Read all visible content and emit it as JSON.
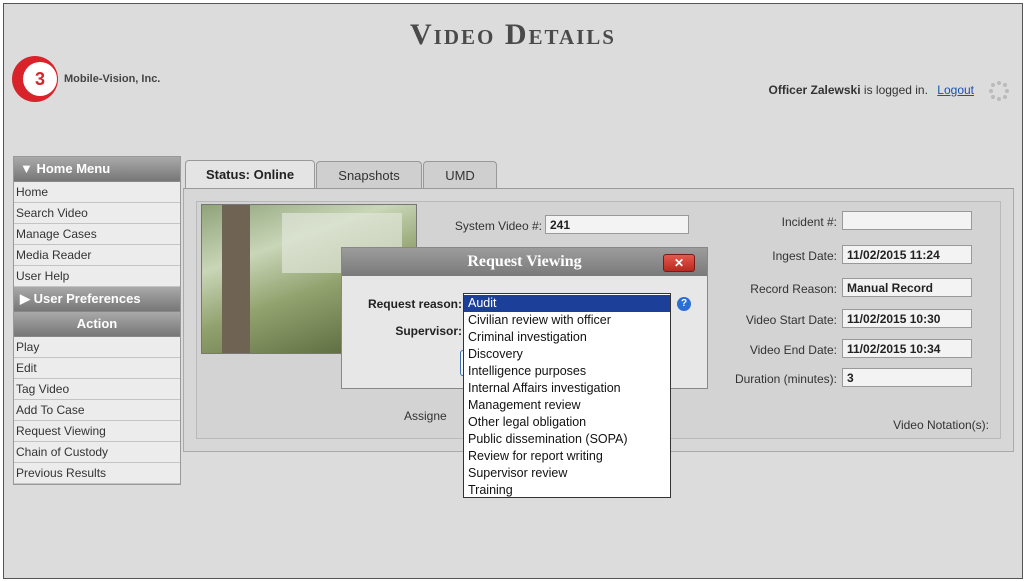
{
  "page": {
    "title": "Video Details",
    "logo_text": "Mobile-Vision, Inc.",
    "logo_mark": "3",
    "login_user": "Officer Zalewski",
    "login_suffix": " is logged in.",
    "logout_label": "Logout"
  },
  "sidebar": {
    "home_menu_header": "▼ Home Menu",
    "home_items": [
      "Home",
      "Search Video",
      "Manage Cases",
      "Media Reader",
      "User Help"
    ],
    "user_prefs_header": "▶ User Preferences",
    "action_header": "Action",
    "action_items": [
      "Play",
      "Edit",
      "Tag Video",
      "Add To Case",
      "Request Viewing",
      "Chain of Custody",
      "Previous Results"
    ]
  },
  "tabs": [
    {
      "label": "Status: Online",
      "active": true
    },
    {
      "label": "Snapshots",
      "active": false
    },
    {
      "label": "UMD",
      "active": false
    }
  ],
  "details": {
    "system_video_label": "System Video #:",
    "system_video_value": "241",
    "incident_label": "Incident #:",
    "incident_value": "",
    "ingest_date_label": "Ingest Date:",
    "ingest_date_value": "11/02/2015 11:24",
    "record_reason_label": "Record Reason:",
    "record_reason_value": "Manual Record",
    "video_start_label": "Video Start Date:",
    "video_start_value": "11/02/2015 10:30",
    "video_end_label": "Video End Date:",
    "video_end_value": "11/02/2015 10:34",
    "duration_label": "Duration (minutes):",
    "duration_value": "3",
    "assigned_label_partial": "Assigne",
    "notation_label": "Video Notation(s):"
  },
  "modal": {
    "title": "Request Viewing",
    "close_label": "✕",
    "request_reason_label": "Request reason:",
    "supervisor_label": "Supervisor:",
    "help_icon": "?",
    "options": [
      "Audit",
      "Civilian review with officer",
      "Criminal investigation",
      "Discovery",
      "Intelligence purposes",
      "Internal Affairs investigation",
      "Management review",
      "Other legal obligation",
      "Public dissemination (SOPA)",
      "Review for report writing",
      "Supervisor review",
      "Training"
    ],
    "selected_option": "Audit"
  },
  "colors": {
    "background": "#dcdcdc",
    "selection": "#1c3f9a",
    "logo_red": "#d8232a",
    "link": "#1a4fb5"
  }
}
